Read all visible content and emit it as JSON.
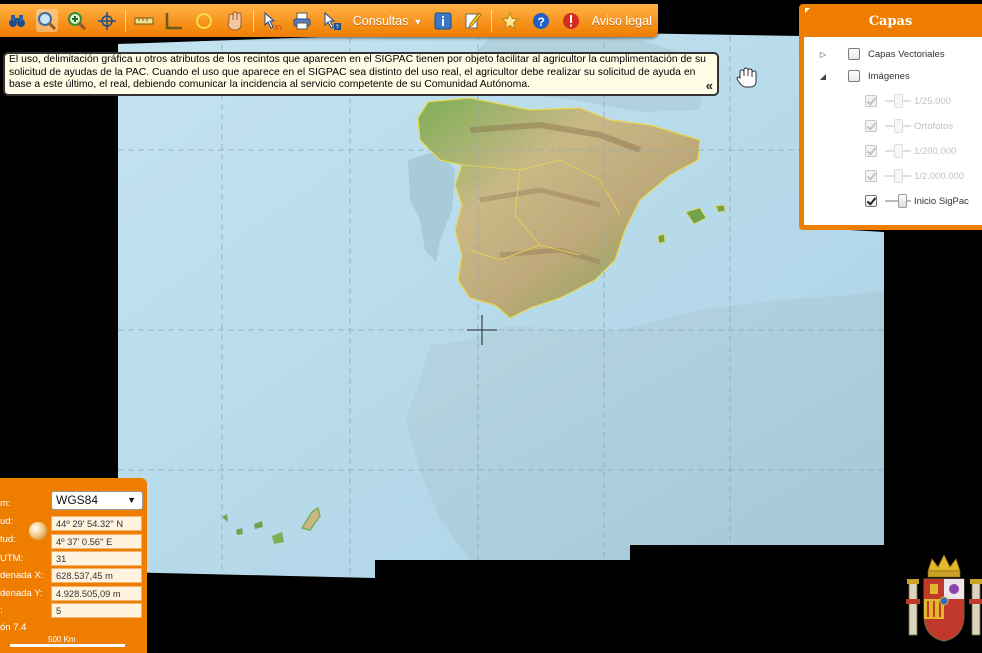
{
  "toolbar": {
    "consultas_label": "Consultas",
    "aviso_label": "Aviso legal"
  },
  "notice": {
    "text": "El uso, delimitación gráfica u otros atributos de los recintos que aparecen en el SIGPAC tienen por objeto facilitar al agricultor la cumplimentación de su solicitud de ayudas de la PAC. Cuando el uso que aparece en el SIGPAC sea distinto del uso real, el agricultor debe realizar su solicitud de ayuda en base a este último, el real, debiendo comunicar la incidencia al servicio competente de su Comunidad Autónoma.",
    "collapse": "«"
  },
  "layers": {
    "title": "Capas",
    "vector_label": "Capas Vectoriales",
    "images_label": "Imágenes",
    "items": [
      {
        "label": "1/25.000",
        "checked": true,
        "enabled": false
      },
      {
        "label": "Ortofotos",
        "checked": true,
        "enabled": false
      },
      {
        "label": "1/200.000",
        "checked": true,
        "enabled": false
      },
      {
        "label": "1/2.000.000",
        "checked": true,
        "enabled": false
      },
      {
        "label": "Inicio SigPac",
        "checked": true,
        "enabled": true
      }
    ]
  },
  "coords": {
    "projection_label": "m:",
    "projection_value": "WGS84",
    "lat_label": "ud:",
    "lat_value": "44º 29' 54.32'' N",
    "lon_label": "tud:",
    "lon_value": "4º 37' 0.56'' E",
    "zone_label": "UTM:",
    "zone_value": "31",
    "x_label": "denada X:",
    "x_value": "628.537,45 m",
    "y_label": "denada Y:",
    "y_value": "4.928.505,09 m",
    "level_label": ":",
    "level_value": "5",
    "version_label": "ón 7.4",
    "scale_label": "500 Km"
  },
  "colors": {
    "accent": "#ef7d00",
    "sea": "#b8dbea",
    "land_green": "#7fae52",
    "land_tan": "#c6b98a"
  }
}
